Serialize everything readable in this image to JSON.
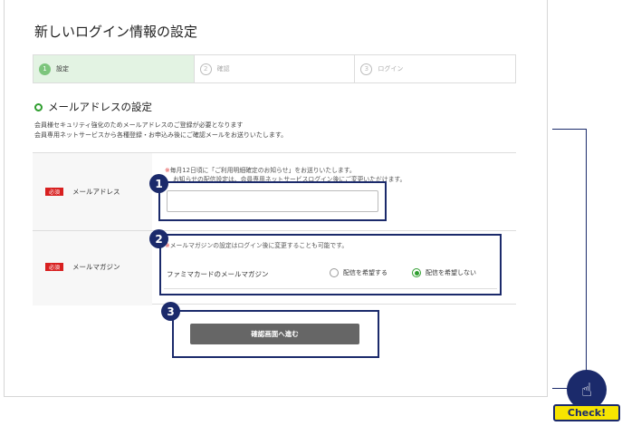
{
  "page": {
    "title": "新しいログイン情報の設定"
  },
  "steps": [
    {
      "num": "1",
      "label": "設定"
    },
    {
      "num": "2",
      "label": "確認"
    },
    {
      "num": "3",
      "label": "ログイン"
    }
  ],
  "section": {
    "heading": "メールアドレスの設定",
    "desc1": "会員様セキュリティ強化のためメールアドレスのご登録が必要となります",
    "desc2": "会員専用ネットサービスから各種登録・お申込み後にご確認メールをお送りいたします。"
  },
  "required_badge": "必須",
  "email": {
    "label": "メールアドレス",
    "note1_mark": "※",
    "note1": "毎月12日頃に「ご利用明細確定のお知らせ」をお送りいたします。",
    "note2": "お知らせの配信設定は、会員専用ネットサービスログイン後にご変更いただけます。",
    "value": "",
    "placeholder": ""
  },
  "magazine": {
    "label": "メールマガジン",
    "note_mark": "※",
    "note": "メールマガジンの設定はログイン後に変更することも可能です。",
    "field_label": "ファミマカードのメールマガジン",
    "option_yes": "配信を希望する",
    "option_no": "配信を希望しない",
    "selected": "配信を希望しない"
  },
  "submit_label": "確認画面へ進む",
  "callouts": [
    "1",
    "2",
    "3"
  ],
  "check_label": "Check!",
  "colors": {
    "accent_green": "#2f9e2f",
    "highlight_navy": "#1b2a6b",
    "required_red": "#d82020",
    "check_yellow": "#f7e400"
  }
}
